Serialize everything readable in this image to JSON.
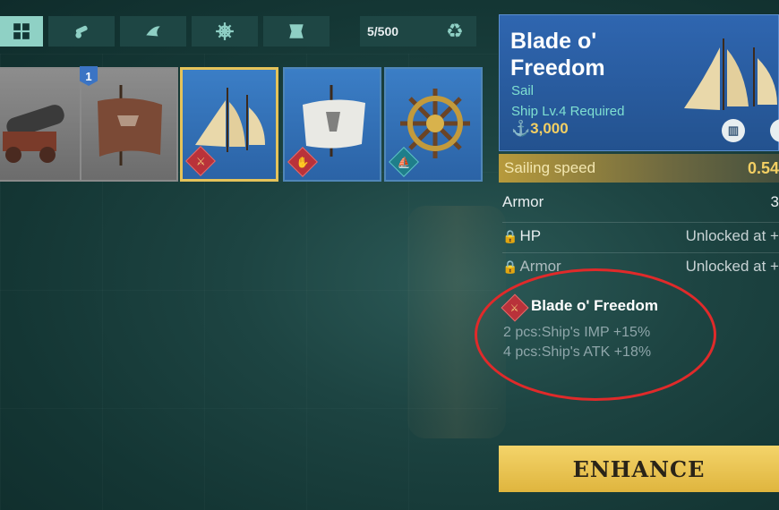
{
  "tabs": [
    {
      "icon": "grid-icon",
      "active": true
    },
    {
      "icon": "cannon-icon",
      "active": false
    },
    {
      "icon": "sail-icon",
      "active": false
    },
    {
      "icon": "helm-wheel-icon",
      "active": false
    },
    {
      "icon": "flag-icon",
      "active": false
    }
  ],
  "inventory": {
    "count": "5/500",
    "items": [
      {
        "kind": "cannon",
        "rarity": "gray"
      },
      {
        "kind": "brown-sail",
        "rarity": "gray",
        "badge": "1"
      },
      {
        "kind": "sail",
        "rarity": "blue",
        "selected": true
      },
      {
        "kind": "white-sail",
        "rarity": "blue"
      },
      {
        "kind": "helm",
        "rarity": "blue"
      }
    ]
  },
  "detail": {
    "name": "Blade o' Freedom",
    "type": "Sail",
    "requirement": "Ship Lv.4 Required",
    "price": "3,000",
    "main_stat": {
      "label": "Sailing speed",
      "value": "0.54"
    },
    "stats": [
      {
        "label": "Armor",
        "value": "3"
      },
      {
        "label": "HP",
        "value": "Unlocked at +",
        "locked": true
      },
      {
        "label": "Armor",
        "value": "Unlocked at +",
        "locked": true
      }
    ],
    "set": {
      "name": "Blade o' Freedom",
      "bonuses": [
        "2 pcs:Ship's IMP +15%",
        "4 pcs:Ship's ATK +18%"
      ]
    },
    "enhance_label": "ENHANCE"
  },
  "colors": {
    "accent_gold": "#f3cf63",
    "teal": "#8fd1c5",
    "panel_blue": "#2f66b0",
    "annotation_red": "#e02a2a"
  }
}
